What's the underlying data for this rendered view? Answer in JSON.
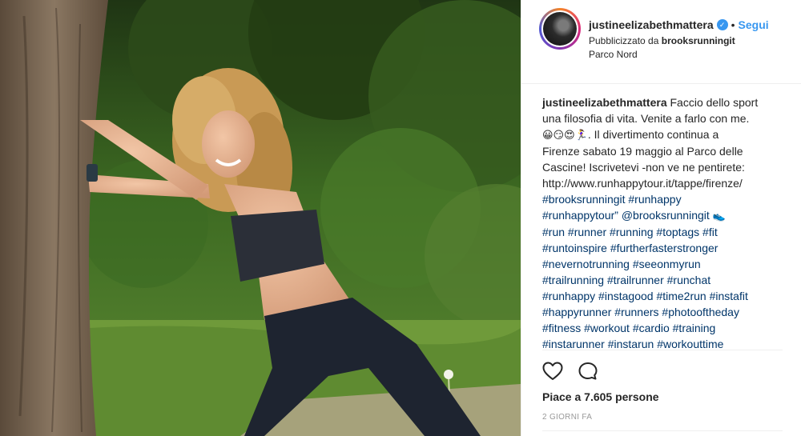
{
  "post": {
    "image_alt": "",
    "header": {
      "username": "justineelizabethmattera",
      "verified": true,
      "separator": "•",
      "follow_label": "Segui",
      "sponsored_prefix": "Pubblicizzato da",
      "sponsored_by": "brooksrunningit",
      "location": "Parco Nord"
    },
    "caption": {
      "username": "justineelizabethmattera",
      "line1_text": "Faccio dello sport",
      "line2": "una filosofia di vita. Venite a farlo con me.",
      "emojis": "😀😏😍🏃‍♀️",
      "line3_text": ". Il divertimento continua a",
      "line4": "Firenze sabato 19 maggio al Parco delle",
      "line5": "Cascine! Iscrivetevi -non ve ne pentirete:",
      "line6": "http://www.runhappytour.it/tappe/firenze/",
      "line7": "#brooksrunningit #runhappy",
      "line8_tag": "#runhappytour”",
      "line8_mention": "@brooksrunningit",
      "line8_emoji": "👟",
      "line9": "#run #runner #running #toptags #fit",
      "line10": "#runtoinspire #furtherfasterstronger",
      "line11": "#nevernotrunning #seeonmyrun",
      "line12": "#trailrunning #trailrunner #runchat",
      "line13": "#runhappy #instagood #time2run #instafit",
      "line14": "#happyrunner #runners #photooftheday",
      "line15": "#fitness #workout #cardio #training",
      "line16": "#instarunner #instarun #workouttime"
    },
    "likes_text": "Piace a 7.605 persone",
    "timestamp": "2 GIORNI FA",
    "icons": {
      "like": "heart-icon",
      "comment": "comment-icon",
      "verified": "verified-badge-icon"
    },
    "colors": {
      "link": "#003569",
      "follow": "#3897f0",
      "verified": "#3897f0",
      "muted": "#999999"
    }
  }
}
